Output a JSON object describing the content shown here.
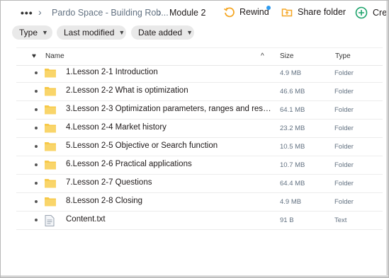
{
  "breadcrumb": {
    "more": "•••",
    "items": [
      "Pardo Space - Building Rob...",
      "Module 2"
    ]
  },
  "toolbar": {
    "rewind_label": "Rewind",
    "share_folder_label": "Share folder",
    "create_label": "Crea"
  },
  "filters": {
    "type": "Type",
    "last_modified": "Last modified",
    "date_added": "Date added"
  },
  "columns": {
    "name": "Name",
    "size": "Size",
    "type": "Type"
  },
  "files": [
    {
      "name": "1.Lesson 2-1 Introduction",
      "size": "4.9 MB",
      "type": "Folder",
      "icon": "folder-icon"
    },
    {
      "name": "2.Lesson 2-2 What is optimization",
      "size": "46.6 MB",
      "type": "Folder",
      "icon": "folder-icon"
    },
    {
      "name": "3.Lesson 2-3 Optimization parameters, ranges and resoluti...",
      "size": "64.1 MB",
      "type": "Folder",
      "icon": "folder-icon"
    },
    {
      "name": "4.Lesson 2-4 Market history",
      "size": "23.2 MB",
      "type": "Folder",
      "icon": "folder-icon"
    },
    {
      "name": "5.Lesson 2-5 Objective or Search function",
      "size": "10.5 MB",
      "type": "Folder",
      "icon": "folder-icon"
    },
    {
      "name": "6.Lesson 2-6 Practical applications",
      "size": "10.7 MB",
      "type": "Folder",
      "icon": "folder-icon"
    },
    {
      "name": "7.Lesson 2-7 Questions",
      "size": "64.4 MB",
      "type": "Folder",
      "icon": "folder-icon"
    },
    {
      "name": "8.Lesson 2-8 Closing",
      "size": "4.9 MB",
      "type": "Folder",
      "icon": "folder-icon"
    },
    {
      "name": "Content.txt",
      "size": "91 B",
      "type": "Text",
      "icon": "text-file-icon"
    }
  ],
  "colors": {
    "folder": "#f7c948",
    "accent_orange": "#f5a623",
    "accent_green": "#1ca36b",
    "notification": "#2e9bf0"
  }
}
